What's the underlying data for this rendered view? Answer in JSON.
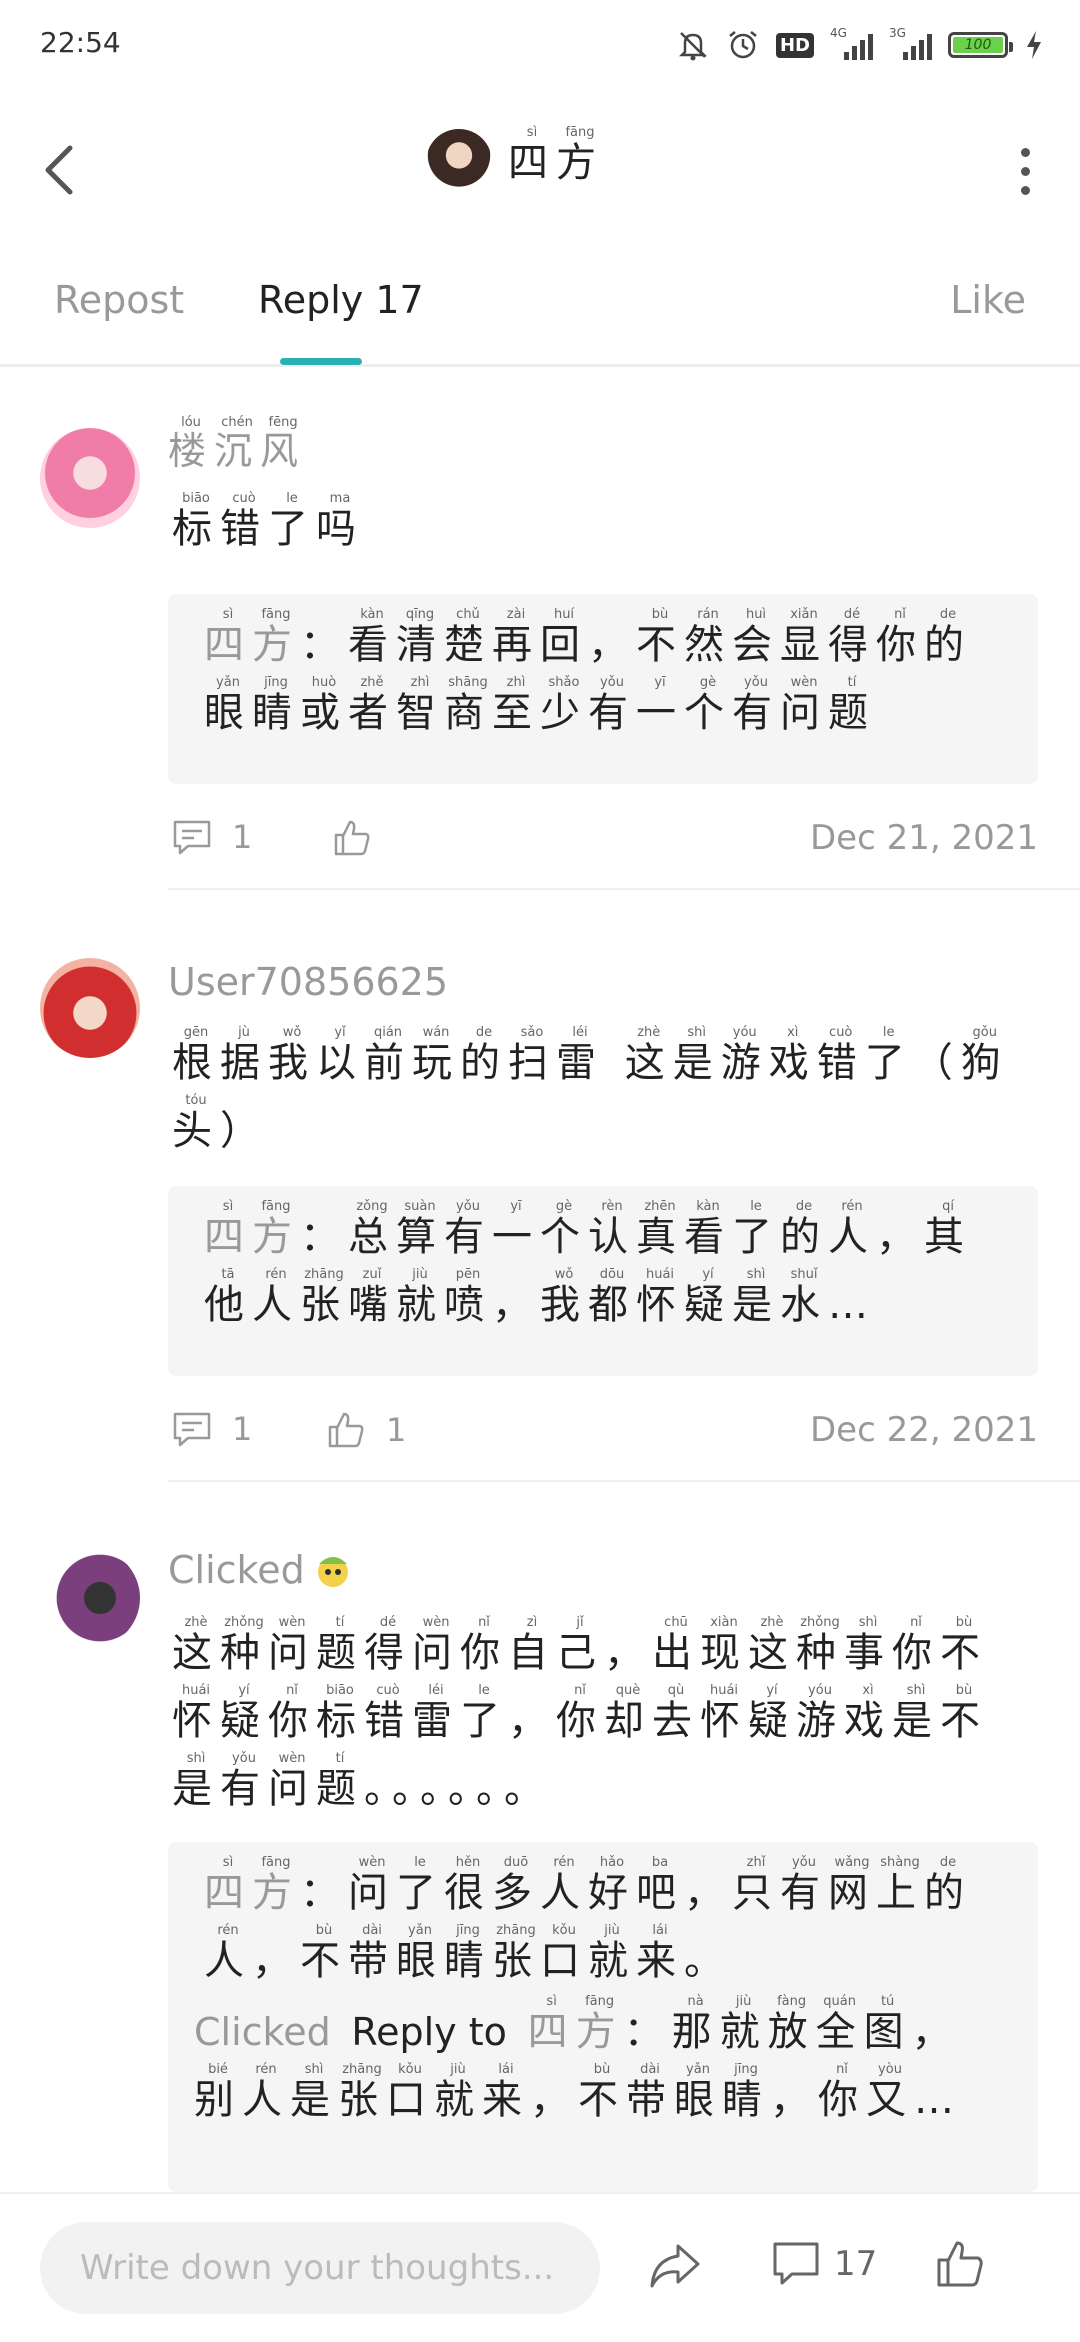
{
  "status": {
    "time": "22:54",
    "network1": "4G",
    "network2": "3G",
    "battery": "100",
    "hd_label": "HD"
  },
  "header": {
    "title": [
      {
        "h": "四",
        "p": "sì"
      },
      {
        "h": "方",
        "p": "fāng"
      }
    ]
  },
  "tabs": {
    "repost": "Repost",
    "reply": "Reply 17",
    "like": "Like"
  },
  "comments": [
    {
      "username_ruby": [
        {
          "h": "楼",
          "p": "lóu"
        },
        {
          "h": "沉",
          "p": "chén"
        },
        {
          "h": "风",
          "p": "fēng"
        }
      ],
      "content": [
        {
          "h": "标",
          "p": "biāo"
        },
        {
          "h": "错",
          "p": "cuò"
        },
        {
          "h": "了",
          "p": "le"
        },
        {
          "h": "吗",
          "p": "ma"
        }
      ],
      "reply_name": [
        {
          "h": "四",
          "p": "sì"
        },
        {
          "h": "方",
          "p": "fāng"
        }
      ],
      "reply_colon": "：",
      "reply_text": [
        {
          "h": "看",
          "p": "kàn"
        },
        {
          "h": "清",
          "p": "qīng"
        },
        {
          "h": "楚",
          "p": "chǔ"
        },
        {
          "h": "再",
          "p": "zài"
        },
        {
          "h": "回",
          "p": "huí"
        },
        {
          "h": "，",
          "p": ""
        },
        {
          "h": "不",
          "p": "bù"
        },
        {
          "h": "然",
          "p": "rán"
        },
        {
          "h": "会",
          "p": "huì"
        },
        {
          "h": "显",
          "p": "xiǎn"
        },
        {
          "h": "得",
          "p": "dé"
        },
        {
          "h": "你",
          "p": "nǐ"
        },
        {
          "h": "的",
          "p": "de"
        },
        {
          "h": "眼",
          "p": "yǎn"
        },
        {
          "h": "睛",
          "p": "jīng"
        },
        {
          "h": "或",
          "p": "huò"
        },
        {
          "h": "者",
          "p": "zhě"
        },
        {
          "h": "智",
          "p": "zhì"
        },
        {
          "h": "商",
          "p": "shāng"
        },
        {
          "h": "至",
          "p": "zhì"
        },
        {
          "h": "少",
          "p": "shǎo"
        },
        {
          "h": "有",
          "p": "yǒu"
        },
        {
          "h": "一",
          "p": "yī"
        },
        {
          "h": "个",
          "p": "gè"
        },
        {
          "h": "有",
          "p": "yǒu"
        },
        {
          "h": "问",
          "p": "wèn"
        },
        {
          "h": "题",
          "p": "tí"
        }
      ],
      "reply_count": "1",
      "like_count": "",
      "date": "Dec 21, 2021"
    },
    {
      "username": "User70856625",
      "content": [
        {
          "h": "根",
          "p": "gēn"
        },
        {
          "h": "据",
          "p": "jù"
        },
        {
          "h": "我",
          "p": "wǒ"
        },
        {
          "h": "以",
          "p": "yǐ"
        },
        {
          "h": "前",
          "p": "qián"
        },
        {
          "h": "玩",
          "p": "wán"
        },
        {
          "h": "的",
          "p": "de"
        },
        {
          "h": "扫",
          "p": "sǎo"
        },
        {
          "h": "雷",
          "p": "léi"
        },
        {
          "h": " ",
          "p": ""
        },
        {
          "h": "这",
          "p": "zhè"
        },
        {
          "h": "是",
          "p": "shì"
        },
        {
          "h": "游",
          "p": "yóu"
        },
        {
          "h": "戏",
          "p": "xì"
        },
        {
          "h": "错",
          "p": "cuò"
        },
        {
          "h": "了",
          "p": "le"
        },
        {
          "h": "（",
          "p": ""
        },
        {
          "h": "狗",
          "p": "gǒu"
        },
        {
          "h": "头",
          "p": "tóu"
        },
        {
          "h": "）",
          "p": ""
        }
      ],
      "reply_name": [
        {
          "h": "四",
          "p": "sì"
        },
        {
          "h": "方",
          "p": "fāng"
        }
      ],
      "reply_colon": "：",
      "reply_text": [
        {
          "h": "总",
          "p": "zǒng"
        },
        {
          "h": "算",
          "p": "suàn"
        },
        {
          "h": "有",
          "p": "yǒu"
        },
        {
          "h": "一",
          "p": "yī"
        },
        {
          "h": "个",
          "p": "gè"
        },
        {
          "h": "认",
          "p": "rèn"
        },
        {
          "h": "真",
          "p": "zhēn"
        },
        {
          "h": "看",
          "p": "kàn"
        },
        {
          "h": "了",
          "p": "le"
        },
        {
          "h": "的",
          "p": "de"
        },
        {
          "h": "人",
          "p": "rén"
        },
        {
          "h": "，",
          "p": ""
        },
        {
          "h": "其",
          "p": "qí"
        },
        {
          "h": "他",
          "p": "tā"
        },
        {
          "h": "人",
          "p": "rén"
        },
        {
          "h": "张",
          "p": "zhāng"
        },
        {
          "h": "嘴",
          "p": "zuǐ"
        },
        {
          "h": "就",
          "p": "jiù"
        },
        {
          "h": "喷",
          "p": "pēn"
        },
        {
          "h": "，",
          "p": ""
        },
        {
          "h": "我",
          "p": "wǒ"
        },
        {
          "h": "都",
          "p": "dōu"
        },
        {
          "h": "怀",
          "p": "huái"
        },
        {
          "h": "疑",
          "p": "yí"
        },
        {
          "h": "是",
          "p": "shì"
        },
        {
          "h": "水",
          "p": "shuǐ"
        },
        {
          "h": "…",
          "p": ""
        }
      ],
      "reply_count": "1",
      "like_count": "1",
      "date": "Dec 22, 2021"
    },
    {
      "username": "Clicked",
      "content": [
        {
          "h": "这",
          "p": "zhè"
        },
        {
          "h": "种",
          "p": "zhǒng"
        },
        {
          "h": "问",
          "p": "wèn"
        },
        {
          "h": "题",
          "p": "tí"
        },
        {
          "h": "得",
          "p": "dé"
        },
        {
          "h": "问",
          "p": "wèn"
        },
        {
          "h": "你",
          "p": "nǐ"
        },
        {
          "h": "自",
          "p": "zì"
        },
        {
          "h": "己",
          "p": "jǐ"
        },
        {
          "h": "，",
          "p": ""
        },
        {
          "h": "出",
          "p": "chū"
        },
        {
          "h": "现",
          "p": "xiàn"
        },
        {
          "h": "这",
          "p": "zhè"
        },
        {
          "h": "种",
          "p": "zhǒng"
        },
        {
          "h": "事",
          "p": "shì"
        },
        {
          "h": "你",
          "p": "nǐ"
        },
        {
          "h": "不",
          "p": "bù"
        },
        {
          "h": "怀",
          "p": "huái"
        },
        {
          "h": "疑",
          "p": "yí"
        },
        {
          "h": "你",
          "p": "nǐ"
        },
        {
          "h": "标",
          "p": "biāo"
        },
        {
          "h": "错",
          "p": "cuò"
        },
        {
          "h": "雷",
          "p": "léi"
        },
        {
          "h": "了",
          "p": "le"
        },
        {
          "h": "，",
          "p": ""
        },
        {
          "h": "你",
          "p": "nǐ"
        },
        {
          "h": "却",
          "p": "què"
        },
        {
          "h": "去",
          "p": "qù"
        },
        {
          "h": "怀",
          "p": "huái"
        },
        {
          "h": "疑",
          "p": "yí"
        },
        {
          "h": "游",
          "p": "yóu"
        },
        {
          "h": "戏",
          "p": "xì"
        },
        {
          "h": "是",
          "p": "shì"
        },
        {
          "h": "不",
          "p": "bù"
        },
        {
          "h": "是",
          "p": "shì"
        },
        {
          "h": "有",
          "p": "yǒu"
        },
        {
          "h": "问",
          "p": "wèn"
        },
        {
          "h": "题",
          "p": "tí"
        },
        {
          "h": "。。。。。。",
          "p": ""
        }
      ],
      "reply_name": [
        {
          "h": "四",
          "p": "sì"
        },
        {
          "h": "方",
          "p": "fāng"
        }
      ],
      "reply_colon": "：",
      "reply_text": [
        {
          "h": "问",
          "p": "wèn"
        },
        {
          "h": "了",
          "p": "le"
        },
        {
          "h": "很",
          "p": "hěn"
        },
        {
          "h": "多",
          "p": "duō"
        },
        {
          "h": "人",
          "p": "rén"
        },
        {
          "h": "好",
          "p": "hǎo"
        },
        {
          "h": "吧",
          "p": "ba"
        },
        {
          "h": "，",
          "p": ""
        },
        {
          "h": "只",
          "p": "zhǐ"
        },
        {
          "h": "有",
          "p": "yǒu"
        },
        {
          "h": "网",
          "p": "wǎng"
        },
        {
          "h": "上",
          "p": "shàng"
        },
        {
          "h": "的",
          "p": "de"
        },
        {
          "h": "人",
          "p": "rén"
        },
        {
          "h": "，",
          "p": ""
        },
        {
          "h": "不",
          "p": "bù"
        },
        {
          "h": "带",
          "p": "dài"
        },
        {
          "h": "眼",
          "p": "yǎn"
        },
        {
          "h": "睛",
          "p": "jīng"
        },
        {
          "h": "张",
          "p": "zhāng"
        },
        {
          "h": "口",
          "p": "kǒu"
        },
        {
          "h": "就",
          "p": "jiù"
        },
        {
          "h": "来",
          "p": "lái"
        },
        {
          "h": "。",
          "p": ""
        }
      ],
      "reply2_user": "Clicked",
      "reply2_to": "Reply to",
      "reply2_name": [
        {
          "h": "四",
          "p": "sì"
        },
        {
          "h": "方",
          "p": "fāng"
        }
      ],
      "reply2_colon": "：",
      "reply2_text": [
        {
          "h": "那",
          "p": "nà"
        },
        {
          "h": "就",
          "p": "jiù"
        },
        {
          "h": "放",
          "p": "fàng"
        },
        {
          "h": "全",
          "p": "quán"
        },
        {
          "h": "图",
          "p": "tú"
        },
        {
          "h": "，",
          "p": ""
        },
        {
          "h": "别",
          "p": "bié"
        },
        {
          "h": "人",
          "p": "rén"
        },
        {
          "h": "是",
          "p": "shì"
        },
        {
          "h": "张",
          "p": "zhāng"
        },
        {
          "h": "口",
          "p": "kǒu"
        },
        {
          "h": "就",
          "p": "jiù"
        },
        {
          "h": "来",
          "p": "lái"
        },
        {
          "h": "，",
          "p": ""
        },
        {
          "h": "不",
          "p": "bù"
        },
        {
          "h": "带",
          "p": "dài"
        },
        {
          "h": "眼",
          "p": "yǎn"
        },
        {
          "h": "睛",
          "p": "jīng"
        },
        {
          "h": "，",
          "p": ""
        },
        {
          "h": "你",
          "p": "nǐ"
        },
        {
          "h": "又",
          "p": "yòu"
        },
        {
          "h": "…",
          "p": ""
        }
      ]
    }
  ],
  "bottom": {
    "placeholder": "Write down your thoughts...",
    "reply_count": "17"
  },
  "colors": {
    "accent": "#29b0b0",
    "battery": "#6bd14a",
    "muted": "#999999"
  }
}
